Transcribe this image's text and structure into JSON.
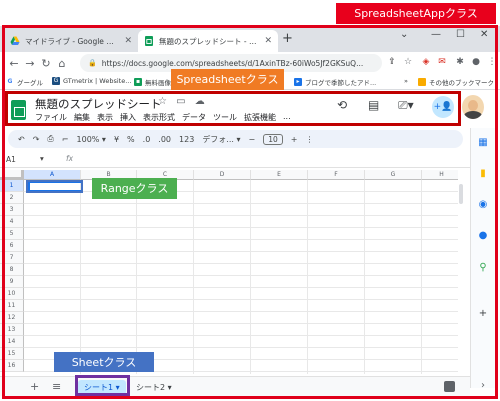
{
  "browser": {
    "tabs": [
      {
        "title": "マイドライブ - Google ドライブ",
        "active": false
      },
      {
        "title": "無題のスプレッドシート - Google スプ",
        "active": true
      }
    ],
    "new_tab_label": "+",
    "url": "https://docs.google.com/spreadsheets/d/1AxinTBz-60iWo5Jf2GKSuQ...",
    "bookmarks": [
      "グーグル",
      "GTmetrix | Website...",
      "無料画像...",
      "ブログで季節したアド...",
      "その他のブックマーク"
    ]
  },
  "spreadsheet": {
    "title": "無題のスプレッドシート",
    "menu": [
      "ファイル",
      "編集",
      "表示",
      "挿入",
      "表示形式",
      "データ",
      "ツール",
      "拡張機能",
      "..."
    ],
    "toolbar": {
      "zoom": "100%",
      "currency": "¥",
      "percent": "%",
      "dec_decrease": ".0",
      "dec_increase": ".00",
      "number_format": "123",
      "font": "デフォ...",
      "font_size": "10"
    },
    "cell_ref": "A1",
    "fx_label": "fx",
    "columns": [
      "A",
      "B",
      "C",
      "D",
      "E",
      "F",
      "G",
      "H"
    ],
    "rows": [
      "1",
      "2",
      "3",
      "4",
      "5",
      "6",
      "7",
      "8",
      "9",
      "10",
      "11",
      "12",
      "13",
      "14",
      "15",
      "16"
    ],
    "sheet_tabs": [
      "シート1",
      "シート2"
    ]
  },
  "annotations": {
    "app_class": "SpreadsheetAppクラス",
    "spreadsheet_class": "Spreadsheetクラス",
    "range_class": "Rangeクラス",
    "sheet_class": "Sheetクラス"
  },
  "colors": {
    "app_frame": "#e0001a",
    "spreadsheet_label": "#f07b24",
    "range_label": "#4caf50",
    "sheet_label": "#4472c4",
    "sheet_frame": "#7030a0"
  }
}
